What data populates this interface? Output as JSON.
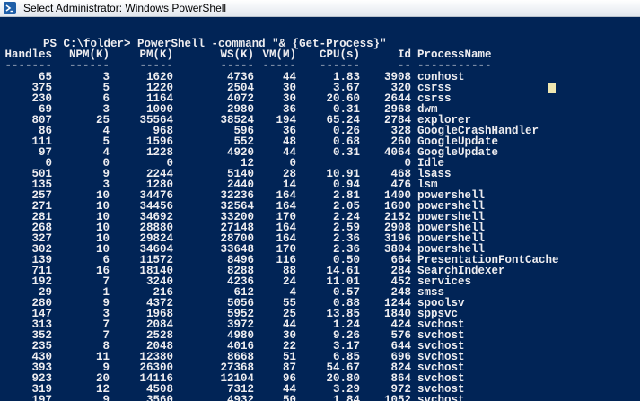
{
  "window": {
    "title": "Select Administrator: Windows PowerShell"
  },
  "console": {
    "prompt": "PS C:\\folder> ",
    "command": "PowerShell -command \"& {Get-Process}\"",
    "columns": [
      "Handles",
      "NPM(K)",
      "PM(K)",
      "WS(K)",
      "VM(M)",
      "CPU(s)",
      "Id",
      "ProcessName"
    ],
    "separators": [
      "-------",
      "------",
      "-----",
      "-----",
      "-----",
      "------",
      "--",
      "-----------"
    ],
    "rows": [
      [
        "65",
        "3",
        "1620",
        "4736",
        "44",
        "1.83",
        "3908",
        "conhost"
      ],
      [
        "375",
        "5",
        "1220",
        "2504",
        "30",
        "3.67",
        "320",
        "csrss"
      ],
      [
        "230",
        "6",
        "1164",
        "4072",
        "30",
        "20.60",
        "2644",
        "csrss"
      ],
      [
        "69",
        "3",
        "1000",
        "2980",
        "36",
        "0.31",
        "2968",
        "dwm"
      ],
      [
        "807",
        "25",
        "35564",
        "38524",
        "194",
        "65.24",
        "2784",
        "explorer"
      ],
      [
        "86",
        "4",
        "968",
        "596",
        "36",
        "0.26",
        "328",
        "GoogleCrashHandler"
      ],
      [
        "111",
        "5",
        "1596",
        "552",
        "48",
        "0.68",
        "260",
        "GoogleUpdate"
      ],
      [
        "97",
        "4",
        "1228",
        "4920",
        "44",
        "0.31",
        "4064",
        "GoogleUpdate"
      ],
      [
        "0",
        "0",
        "0",
        "12",
        "0",
        "",
        "0",
        "Idle"
      ],
      [
        "501",
        "9",
        "2244",
        "5140",
        "28",
        "10.91",
        "468",
        "lsass"
      ],
      [
        "135",
        "3",
        "1280",
        "2440",
        "14",
        "0.94",
        "476",
        "lsm"
      ],
      [
        "257",
        "10",
        "34476",
        "32236",
        "164",
        "2.81",
        "1400",
        "powershell"
      ],
      [
        "271",
        "10",
        "34456",
        "32564",
        "164",
        "2.05",
        "1600",
        "powershell"
      ],
      [
        "281",
        "10",
        "34692",
        "33200",
        "170",
        "2.24",
        "2152",
        "powershell"
      ],
      [
        "268",
        "10",
        "28880",
        "27148",
        "164",
        "2.59",
        "2908",
        "powershell"
      ],
      [
        "327",
        "10",
        "29824",
        "28700",
        "164",
        "2.36",
        "3196",
        "powershell"
      ],
      [
        "302",
        "10",
        "34604",
        "33648",
        "170",
        "2.36",
        "3804",
        "powershell"
      ],
      [
        "139",
        "6",
        "11572",
        "8496",
        "116",
        "0.50",
        "664",
        "PresentationFontCache"
      ],
      [
        "711",
        "16",
        "18140",
        "8288",
        "88",
        "14.61",
        "284",
        "SearchIndexer"
      ],
      [
        "192",
        "7",
        "3240",
        "4236",
        "24",
        "11.01",
        "452",
        "services"
      ],
      [
        "29",
        "1",
        "216",
        "612",
        "4",
        "0.57",
        "248",
        "smss"
      ],
      [
        "280",
        "9",
        "4372",
        "5056",
        "55",
        "0.88",
        "1244",
        "spoolsv"
      ],
      [
        "147",
        "3",
        "1968",
        "5952",
        "25",
        "13.85",
        "1840",
        "sppsvc"
      ],
      [
        "313",
        "7",
        "2084",
        "3972",
        "44",
        "1.24",
        "424",
        "svchost"
      ],
      [
        "352",
        "7",
        "2528",
        "4980",
        "30",
        "9.26",
        "576",
        "svchost"
      ],
      [
        "235",
        "8",
        "2048",
        "4016",
        "22",
        "3.17",
        "644",
        "svchost"
      ],
      [
        "430",
        "11",
        "12380",
        "8668",
        "51",
        "6.85",
        "696",
        "svchost"
      ],
      [
        "393",
        "9",
        "26300",
        "27368",
        "87",
        "54.67",
        "824",
        "svchost"
      ],
      [
        "923",
        "20",
        "14116",
        "12104",
        "96",
        "20.80",
        "864",
        "svchost"
      ],
      [
        "319",
        "12",
        "4508",
        "7312",
        "44",
        "3.29",
        "972",
        "svchost"
      ],
      [
        "197",
        "9",
        "3560",
        "4932",
        "50",
        "1.84",
        "1052",
        "svchost"
      ]
    ]
  }
}
